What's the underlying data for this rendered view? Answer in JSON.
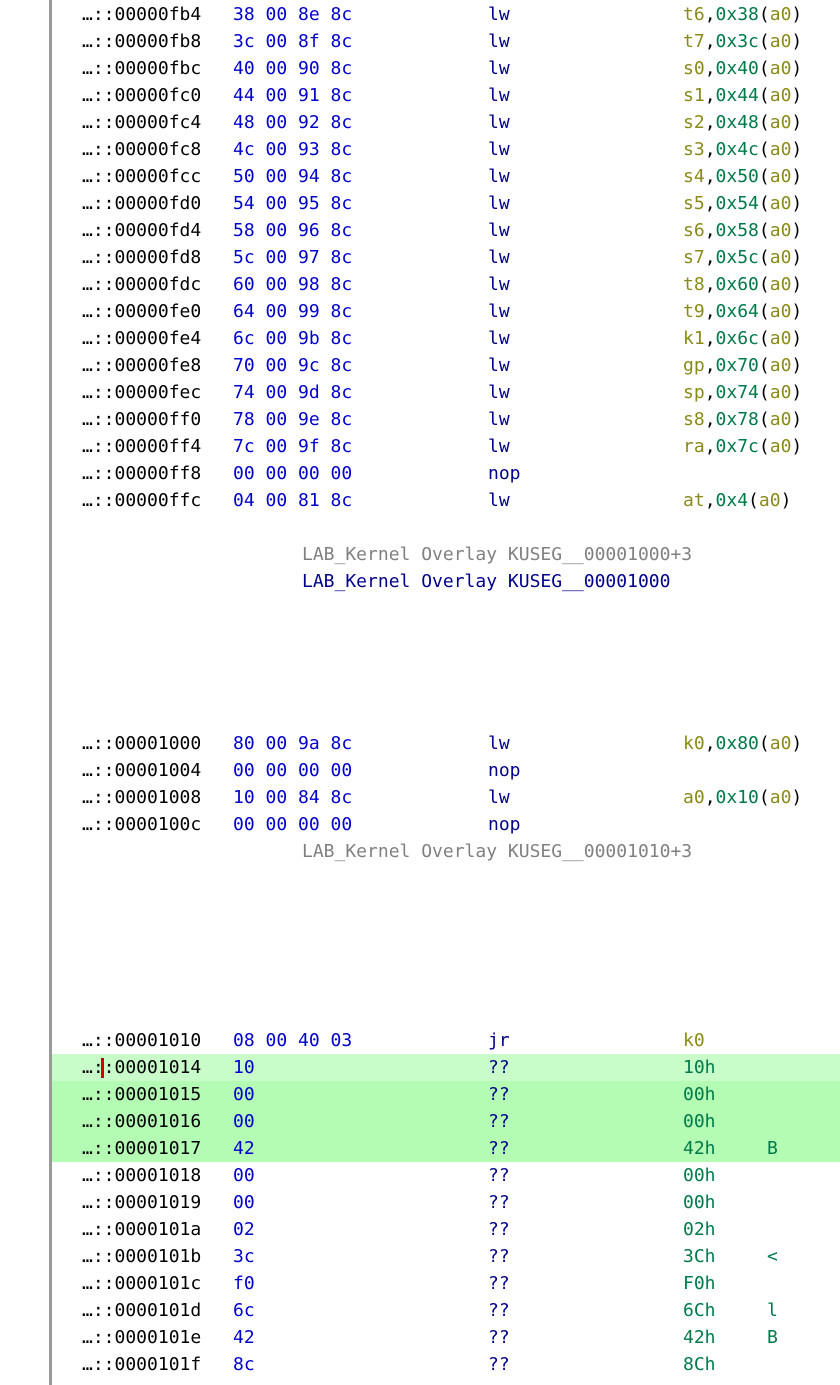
{
  "colors": {
    "address": "#000000",
    "bytes": "#0000cc",
    "mnemonic": "#00008b",
    "register": "#8a8a1a",
    "immediate": "#007a4a",
    "label_ref": "#808080",
    "label_def": "#00008b",
    "selection": "#b4fbb4",
    "cursor": "#cc0000"
  },
  "rows": [
    {
      "kind": "ins",
      "addr": "…::00000fb4",
      "bytes": "38 00 8e 8c",
      "mn": "lw",
      "r1": "t6",
      "imm": "0x38",
      "r2": "a0"
    },
    {
      "kind": "ins",
      "addr": "…::00000fb8",
      "bytes": "3c 00 8f 8c",
      "mn": "lw",
      "r1": "t7",
      "imm": "0x3c",
      "r2": "a0"
    },
    {
      "kind": "ins",
      "addr": "…::00000fbc",
      "bytes": "40 00 90 8c",
      "mn": "lw",
      "r1": "s0",
      "imm": "0x40",
      "r2": "a0"
    },
    {
      "kind": "ins",
      "addr": "…::00000fc0",
      "bytes": "44 00 91 8c",
      "mn": "lw",
      "r1": "s1",
      "imm": "0x44",
      "r2": "a0"
    },
    {
      "kind": "ins",
      "addr": "…::00000fc4",
      "bytes": "48 00 92 8c",
      "mn": "lw",
      "r1": "s2",
      "imm": "0x48",
      "r2": "a0"
    },
    {
      "kind": "ins",
      "addr": "…::00000fc8",
      "bytes": "4c 00 93 8c",
      "mn": "lw",
      "r1": "s3",
      "imm": "0x4c",
      "r2": "a0"
    },
    {
      "kind": "ins",
      "addr": "…::00000fcc",
      "bytes": "50 00 94 8c",
      "mn": "lw",
      "r1": "s4",
      "imm": "0x50",
      "r2": "a0"
    },
    {
      "kind": "ins",
      "addr": "…::00000fd0",
      "bytes": "54 00 95 8c",
      "mn": "lw",
      "r1": "s5",
      "imm": "0x54",
      "r2": "a0"
    },
    {
      "kind": "ins",
      "addr": "…::00000fd4",
      "bytes": "58 00 96 8c",
      "mn": "lw",
      "r1": "s6",
      "imm": "0x58",
      "r2": "a0"
    },
    {
      "kind": "ins",
      "addr": "…::00000fd8",
      "bytes": "5c 00 97 8c",
      "mn": "lw",
      "r1": "s7",
      "imm": "0x5c",
      "r2": "a0"
    },
    {
      "kind": "ins",
      "addr": "…::00000fdc",
      "bytes": "60 00 98 8c",
      "mn": "lw",
      "r1": "t8",
      "imm": "0x60",
      "r2": "a0"
    },
    {
      "kind": "ins",
      "addr": "…::00000fe0",
      "bytes": "64 00 99 8c",
      "mn": "lw",
      "r1": "t9",
      "imm": "0x64",
      "r2": "a0"
    },
    {
      "kind": "ins",
      "addr": "…::00000fe4",
      "bytes": "6c 00 9b 8c",
      "mn": "lw",
      "r1": "k1",
      "imm": "0x6c",
      "r2": "a0"
    },
    {
      "kind": "ins",
      "addr": "…::00000fe8",
      "bytes": "70 00 9c 8c",
      "mn": "lw",
      "r1": "gp",
      "imm": "0x70",
      "r2": "a0"
    },
    {
      "kind": "ins",
      "addr": "…::00000fec",
      "bytes": "74 00 9d 8c",
      "mn": "lw",
      "r1": "sp",
      "imm": "0x74",
      "r2": "a0"
    },
    {
      "kind": "ins",
      "addr": "…::00000ff0",
      "bytes": "78 00 9e 8c",
      "mn": "lw",
      "r1": "s8",
      "imm": "0x78",
      "r2": "a0"
    },
    {
      "kind": "ins",
      "addr": "…::00000ff4",
      "bytes": "7c 00 9f 8c",
      "mn": "lw",
      "r1": "ra",
      "imm": "0x7c",
      "r2": "a0"
    },
    {
      "kind": "ins",
      "addr": "…::00000ff8",
      "bytes": "00 00 00 00",
      "mn": "nop"
    },
    {
      "kind": "ins",
      "addr": "…::00000ffc",
      "bytes": "04 00 81 8c",
      "mn": "lw",
      "r1": "at",
      "imm": "0x4",
      "r2": "a0"
    },
    {
      "kind": "blank"
    },
    {
      "kind": "label",
      "style": "ref",
      "text": "LAB_Kernel Overlay KUSEG__00001000+3"
    },
    {
      "kind": "label",
      "style": "def",
      "text": "LAB_Kernel Overlay KUSEG__00001000"
    },
    {
      "kind": "blank"
    },
    {
      "kind": "blank"
    },
    {
      "kind": "blank"
    },
    {
      "kind": "blank"
    },
    {
      "kind": "blank"
    },
    {
      "kind": "ins",
      "addr": "…::00001000",
      "bytes": "80 00 9a 8c",
      "mn": "lw",
      "r1": "k0",
      "imm": "0x80",
      "r2": "a0"
    },
    {
      "kind": "ins",
      "addr": "…::00001004",
      "bytes": "00 00 00 00",
      "mn": "nop"
    },
    {
      "kind": "ins",
      "addr": "…::00001008",
      "bytes": "10 00 84 8c",
      "mn": "lw",
      "r1": "a0",
      "imm": "0x10",
      "r2": "a0"
    },
    {
      "kind": "ins",
      "addr": "…::0000100c",
      "bytes": "00 00 00 00",
      "mn": "nop"
    },
    {
      "kind": "label",
      "style": "ref",
      "text": "LAB_Kernel Overlay KUSEG__00001010+3"
    },
    {
      "kind": "blank"
    },
    {
      "kind": "blank"
    },
    {
      "kind": "blank"
    },
    {
      "kind": "blank"
    },
    {
      "kind": "blank"
    },
    {
      "kind": "blank"
    },
    {
      "kind": "ins",
      "addr": "…::00001010",
      "bytes": "08 00 40 03",
      "mn": "jr",
      "r1": "k0"
    },
    {
      "kind": "data",
      "addr": "…::00001014",
      "bytes": "10",
      "mn": "??",
      "val": "10h",
      "ch": "",
      "hl": true,
      "cursor": true
    },
    {
      "kind": "data",
      "addr": "…::00001015",
      "bytes": "00",
      "mn": "??",
      "val": "00h",
      "ch": "",
      "hl": true
    },
    {
      "kind": "data",
      "addr": "…::00001016",
      "bytes": "00",
      "mn": "??",
      "val": "00h",
      "ch": "",
      "hl": true
    },
    {
      "kind": "data",
      "addr": "…::00001017",
      "bytes": "42",
      "mn": "??",
      "val": "42h",
      "ch": "B",
      "hl": true
    },
    {
      "kind": "data",
      "addr": "…::00001018",
      "bytes": "00",
      "mn": "??",
      "val": "00h",
      "ch": ""
    },
    {
      "kind": "data",
      "addr": "…::00001019",
      "bytes": "00",
      "mn": "??",
      "val": "00h",
      "ch": ""
    },
    {
      "kind": "data",
      "addr": "…::0000101a",
      "bytes": "02",
      "mn": "??",
      "val": "02h",
      "ch": ""
    },
    {
      "kind": "data",
      "addr": "…::0000101b",
      "bytes": "3c",
      "mn": "??",
      "val": "3Ch",
      "ch": "<"
    },
    {
      "kind": "data",
      "addr": "…::0000101c",
      "bytes": "f0",
      "mn": "??",
      "val": "F0h",
      "ch": ""
    },
    {
      "kind": "data",
      "addr": "…::0000101d",
      "bytes": "6c",
      "mn": "??",
      "val": "6Ch",
      "ch": "l"
    },
    {
      "kind": "data",
      "addr": "…::0000101e",
      "bytes": "42",
      "mn": "??",
      "val": "42h",
      "ch": "B"
    },
    {
      "kind": "data",
      "addr": "…::0000101f",
      "bytes": "8c",
      "mn": "??",
      "val": "8Ch",
      "ch": ""
    }
  ]
}
